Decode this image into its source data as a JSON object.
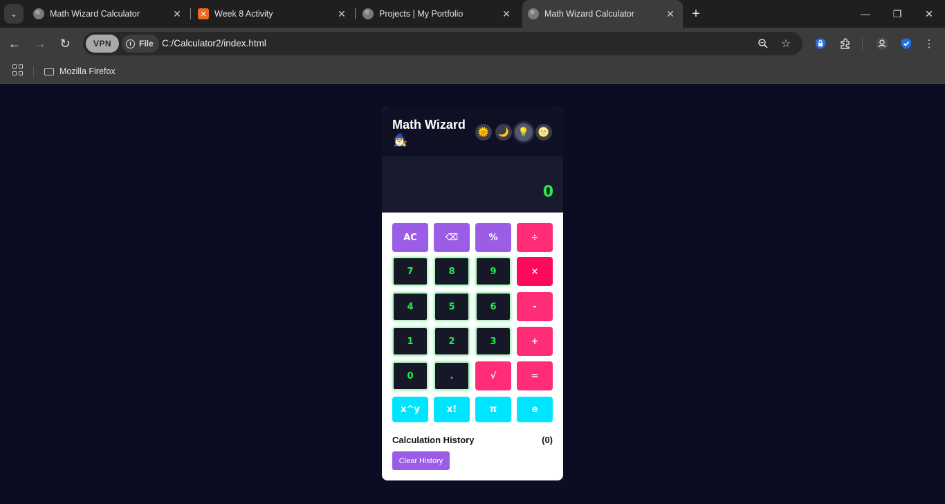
{
  "browser": {
    "tabs": [
      {
        "title": "Math Wizard Calculator",
        "favicon": "globe-icon"
      },
      {
        "title": "Week 8 Activity",
        "favicon": "xampp-icon"
      },
      {
        "title": "Projects | My Portfolio",
        "favicon": "globe-icon"
      },
      {
        "title": "Math Wizard Calculator",
        "favicon": "globe-icon",
        "active": true
      }
    ],
    "vpn_label": "VPN",
    "file_label": "File",
    "url": "C:/Calculator2/index.html",
    "bookmarks": [
      {
        "label": "Mozilla Firefox",
        "icon": "folder-icon"
      }
    ]
  },
  "calculator": {
    "title": "Math Wizard",
    "title_emoji": "🧙‍♂️",
    "themes": [
      {
        "icon": "🌞",
        "name": "sun-theme-icon"
      },
      {
        "icon": "🌙",
        "name": "moon-theme-icon"
      },
      {
        "icon": "💡",
        "name": "bulb-theme-icon",
        "active": true
      },
      {
        "icon": "🌝",
        "name": "face-theme-icon"
      }
    ],
    "display": "0",
    "keys": {
      "ac": "AC",
      "backspace": "⌫",
      "percent": "%",
      "divide": "÷",
      "seven": "7",
      "eight": "8",
      "nine": "9",
      "multiply": "×",
      "four": "4",
      "five": "5",
      "six": "6",
      "minus": "-",
      "one": "1",
      "two": "2",
      "three": "3",
      "plus": "+",
      "zero": "0",
      "decimal": ".",
      "sqrt": "√",
      "equals": "=",
      "power": "x^y",
      "factorial": "x!",
      "pi": "π",
      "euler": "e"
    },
    "history": {
      "title": "Calculation History",
      "count": "(0)",
      "clear_label": "Clear History"
    }
  }
}
